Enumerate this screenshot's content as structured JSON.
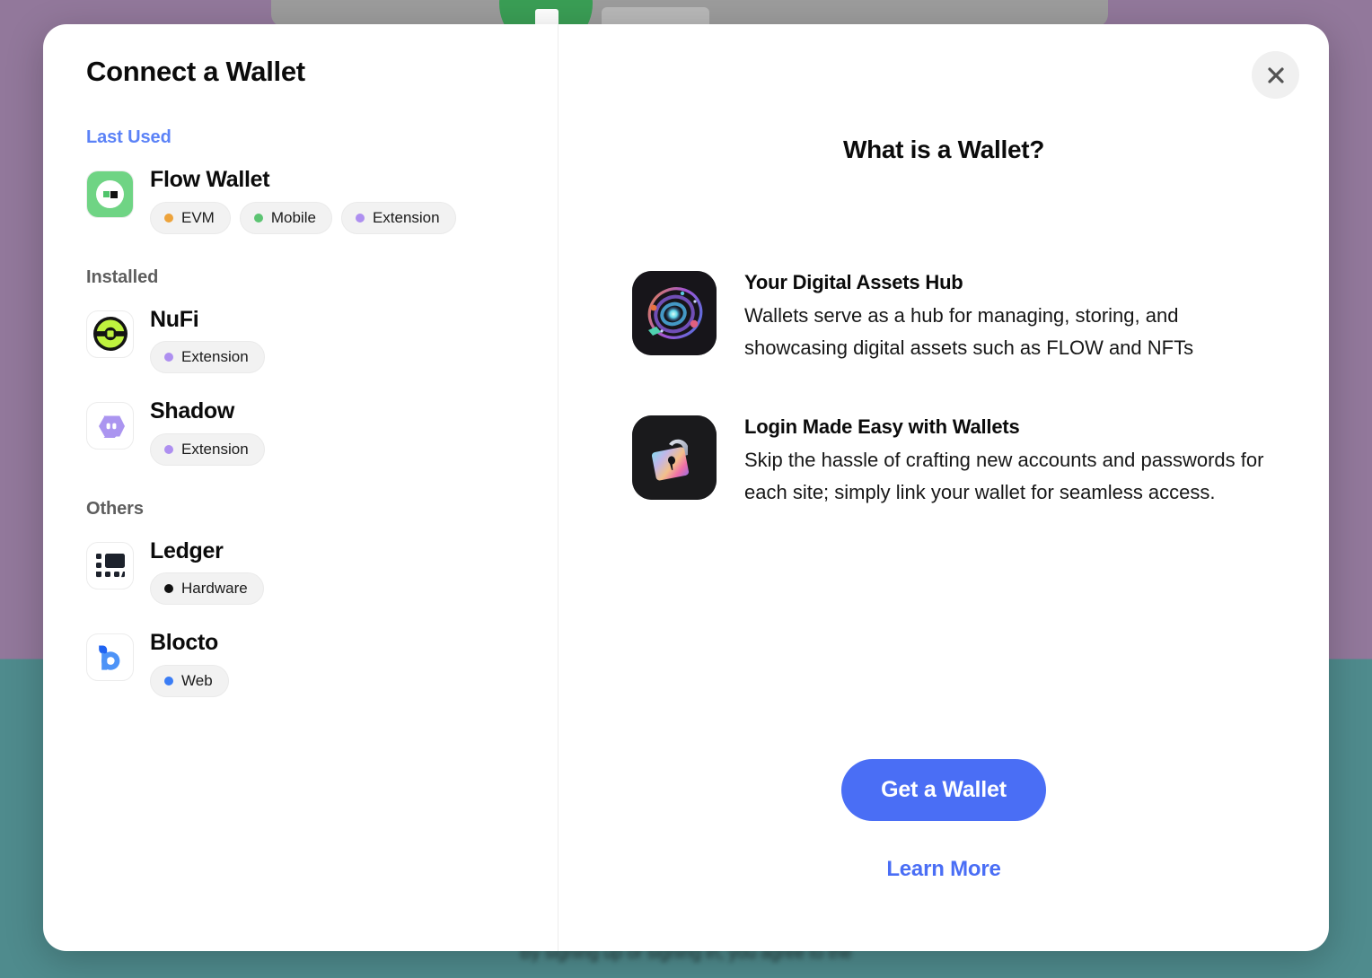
{
  "backdrop": {
    "terms_text": "By signing up or signing in, you agree to the",
    "top_color": "#92789b",
    "bottom_color": "#4f8b8d"
  },
  "modal": {
    "title": "Connect a Wallet",
    "close_icon": "close-icon"
  },
  "sidebar": {
    "groups": [
      {
        "label": "Last Used",
        "style": "accent",
        "wallets": [
          {
            "name": "Flow Wallet",
            "icon": "flow-wallet-icon",
            "badges": [
              {
                "label": "EVM",
                "dot_color": "#eda33b"
              },
              {
                "label": "Mobile",
                "dot_color": "#5cc472"
              },
              {
                "label": "Extension",
                "dot_color": "#ae8ff0"
              }
            ]
          }
        ]
      },
      {
        "label": "Installed",
        "style": "muted",
        "wallets": [
          {
            "name": "NuFi",
            "icon": "nufi-icon",
            "badges": [
              {
                "label": "Extension",
                "dot_color": "#ae8ff0"
              }
            ]
          },
          {
            "name": "Shadow",
            "icon": "shadow-icon",
            "badges": [
              {
                "label": "Extension",
                "dot_color": "#ae8ff0"
              }
            ]
          }
        ]
      },
      {
        "label": "Others",
        "style": "muted",
        "wallets": [
          {
            "name": "Ledger",
            "icon": "ledger-icon",
            "badges": [
              {
                "label": "Hardware",
                "dot_color": "#111111"
              }
            ]
          },
          {
            "name": "Blocto",
            "icon": "blocto-icon",
            "badges": [
              {
                "label": "Web",
                "dot_color": "#3b7df5"
              }
            ]
          }
        ]
      }
    ]
  },
  "info_panel": {
    "title": "What is a Wallet?",
    "features": [
      {
        "icon": "galaxy-icon",
        "title": "Your Digital Assets Hub",
        "description": "Wallets serve as a hub for managing, storing, and showcasing digital assets such as FLOW and NFTs"
      },
      {
        "icon": "padlock-icon",
        "title": "Login Made Easy with Wallets",
        "description": "Skip the hassle of crafting new accounts and passwords for each site; simply link your wallet for seamless access."
      }
    ],
    "primary_button": "Get a Wallet",
    "secondary_link": "Learn More",
    "accent_color": "#4a6ef5"
  }
}
